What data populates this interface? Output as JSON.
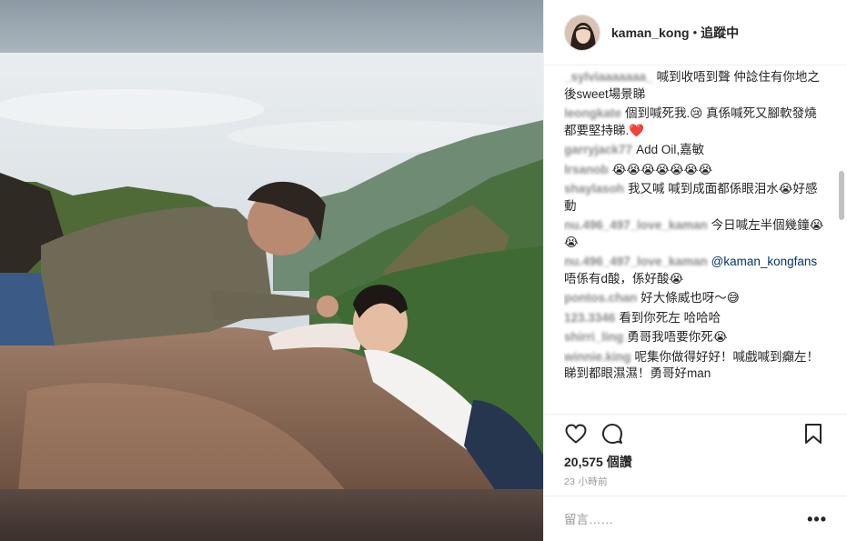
{
  "post": {
    "username": "kaman_kong",
    "separator": "•",
    "follow_status": "追蹤中"
  },
  "comments": [
    {
      "user": "_sylviaaaaaaa_",
      "text": "喊到收唔到聲 仲諗住有你地之後sweet場景睇",
      "blurred": true
    },
    {
      "user": "leongkate",
      "text": "個到喊死我.😢 真係喊死又腳軟發燒都要堅持睇.❤️",
      "blurred": true
    },
    {
      "user": "garryjack77",
      "text": "Add Oil,嘉敏",
      "blurred": true
    },
    {
      "user": "lrsanob",
      "text": "😭😭😭😭😭😭😭",
      "blurred": true
    },
    {
      "user": "shaylasoh",
      "text": "我又喊 喊到成面都係眼泪水😭好感動",
      "blurred": true
    },
    {
      "user": "nu.496_497_love_kaman",
      "text": "今日喊左半個幾鐘😭😭",
      "blurred": true
    },
    {
      "user": "nu.496_497_love_kaman",
      "mention": "@kaman_kongfans",
      "text": " 唔係有d酸，係好酸😭",
      "blurred": true
    },
    {
      "user": "pontos.chan",
      "text": "好大條威也呀～😅",
      "blurred": true
    },
    {
      "user": "123.3346",
      "text": "看到你死左 哈哈哈",
      "blurred": true
    },
    {
      "user": "shirri_ling",
      "text": "勇哥我唔要你死😭",
      "blurred": true
    },
    {
      "user": "winnie.king",
      "text": "呢集你做得好好！喊戲喊到癲左！睇到都眼濕濕！勇哥好man",
      "blurred": true
    }
  ],
  "likes": "20,575 個讚",
  "timestamp": "23 小時前",
  "comment_input": {
    "placeholder": "留言……"
  },
  "more_label": "•••",
  "icons": {
    "like": "heart-icon",
    "comment": "comment-bubble-icon",
    "save": "bookmark-icon",
    "options": "more-options-icon"
  }
}
